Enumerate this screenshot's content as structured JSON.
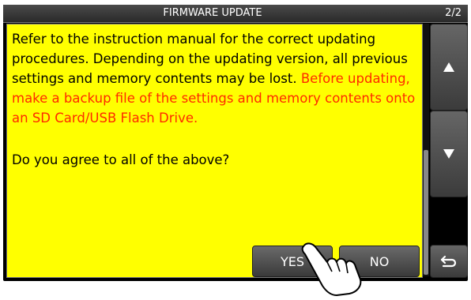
{
  "header": {
    "title": "FIRMWARE UPDATE",
    "page": "2/2"
  },
  "message": {
    "body": "Refer to the instruction manual for the correct updating procedures. Depending on the updating version, all previous settings and memory contents may be lost.",
    "warning": "Before updating, make a backup file of the settings and memory contents onto an SD Card/USB Flash Drive.",
    "question": "Do you agree to all of the above?"
  },
  "buttons": {
    "yes": "YES",
    "no": "NO"
  },
  "icons": {
    "up": "up-arrow-icon",
    "down": "down-arrow-icon",
    "back": "return-icon",
    "hand": "pointing-hand-icon"
  },
  "colors": {
    "content_bg": "#ffff00",
    "warning_text": "#ff2a00",
    "title_bg": "#333333"
  }
}
